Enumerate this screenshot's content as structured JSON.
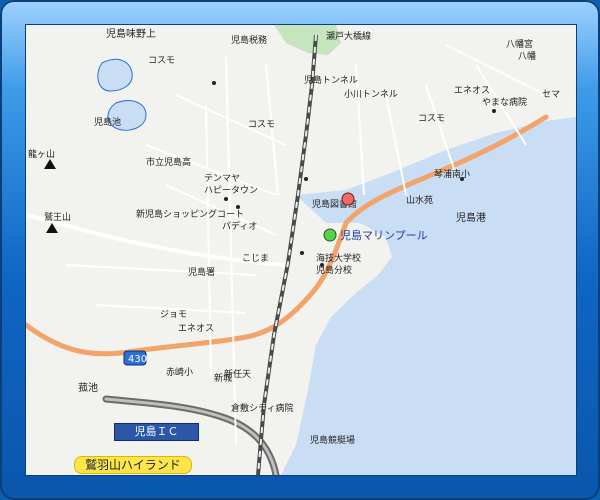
{
  "map": {
    "labels": {
      "top_left": "児島味野上",
      "mosquito_left": "コスモ",
      "station_post": "児島税務",
      "pond": "児島池",
      "mountain1": "鷲王山",
      "mountain2": "龍ヶ山",
      "school1": "市立児島高",
      "tenmaya": "テンマヤ",
      "happytown": "ハピータウン",
      "shoppingcourt": "新児島ショッピングコート",
      "paddeo": "パディオ",
      "kojima_station": "こじま",
      "kojima_ward": "児島署",
      "jomo": "ジョモ",
      "eneos_bottom": "エネオス",
      "akasaki": "赤崎小",
      "saiso": "菰池",
      "shinitei": "新任天",
      "kurashiki_cooperative": "倉敷シティ病院",
      "shin_jo": "新城",
      "cosmo_mid": "コスモ",
      "cosmo_right": "コスモ",
      "eneos_top": "エネオス",
      "yamanaka": "やまな病院",
      "kojima_tunnel": "児島トンネル",
      "ogawa_tunnel": "小川トンネル",
      "seto_line": "瀬戸大橋線",
      "library": "児島図書館",
      "harbor": "児島港",
      "marine_pool": "児島マリンプール",
      "kaiji_univ": "海技大学校",
      "kaiji_branch": "児島分校",
      "fishing": "琴浦南小",
      "yamakoen": "山水苑",
      "cema": "セマ",
      "misaki_hachiman": "八幡宮",
      "yama_yama": "八幡",
      "kojima_kyo": "児島競艇場",
      "route_num": "430",
      "kojima_ic": "児島ＩＣ",
      "washu_highland": "鷲羽山ハイランド"
    },
    "colors": {
      "sea": "#c9ddf4",
      "land": "#f2f2ee",
      "route": "#f2a46a",
      "rail": "#4a4a4a",
      "water_line": "#2b6fd6",
      "marker_red": "#f06a6a",
      "marker_green": "#56d34a"
    }
  }
}
